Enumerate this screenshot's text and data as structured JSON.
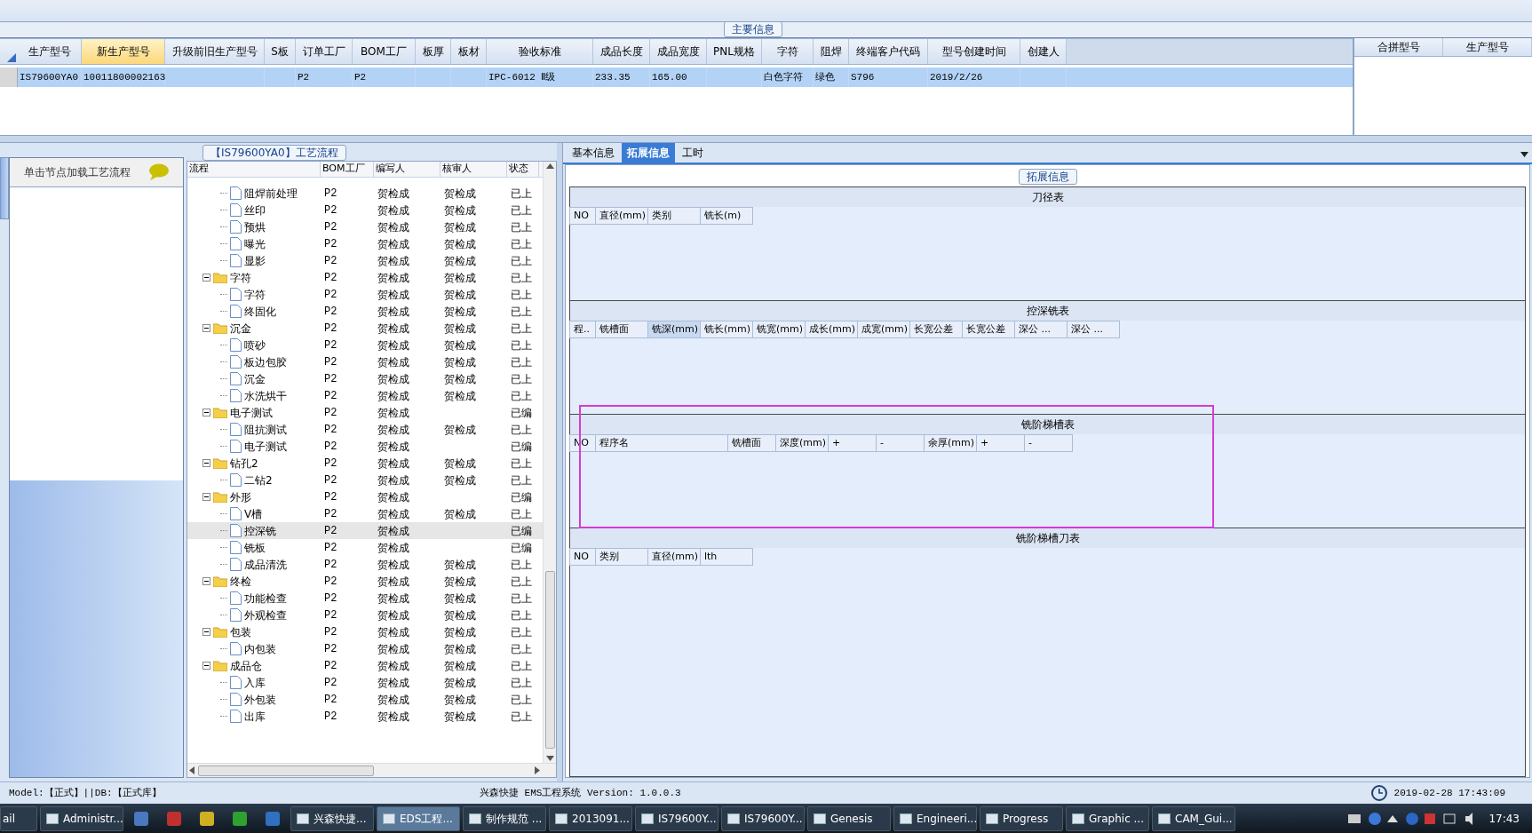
{
  "main_info": {
    "title": "主要信息",
    "columns": [
      {
        "label": "生产型号",
        "selected": false
      },
      {
        "label": "新生产型号",
        "selected": true
      },
      {
        "label": "升级前旧生产型号",
        "selected": false
      },
      {
        "label": "S板",
        "selected": false
      },
      {
        "label": "订单工厂",
        "selected": false
      },
      {
        "label": "BOM工厂",
        "selected": false
      },
      {
        "label": "板厚",
        "selected": false
      },
      {
        "label": "板材",
        "selected": false
      },
      {
        "label": "验收标准",
        "selected": false
      },
      {
        "label": "成品长度",
        "selected": false
      },
      {
        "label": "成品宽度",
        "selected": false
      },
      {
        "label": "PNL规格",
        "selected": false
      },
      {
        "label": "字符",
        "selected": false
      },
      {
        "label": "阻焊",
        "selected": false
      },
      {
        "label": "终端客户代码",
        "selected": false
      },
      {
        "label": "型号创建时间",
        "selected": false
      },
      {
        "label": "创建人",
        "selected": false
      }
    ],
    "rows": [
      {
        "selected": true,
        "cells": [
          "IS79600YA0",
          "10011800002163",
          null,
          null,
          "P2",
          "P2",
          null,
          null,
          "IPC-6012 Ⅱ级",
          "233.35",
          "165.00",
          null,
          "白色字符",
          "绿色",
          "S796",
          "2019/2/26",
          null
        ]
      }
    ],
    "merge_columns": [
      "合拼型号",
      "生产型号"
    ]
  },
  "left_panel": {
    "hint": "单击节点加载工艺流程"
  },
  "process_flow": {
    "title": "【IS79600YA0】工艺流程",
    "columns": [
      "流程",
      "BOM工厂",
      "编写人",
      "核审人",
      "状态"
    ],
    "items": [
      {
        "children": [
          {
            "name": "阻焊前处理",
            "bom": "P2",
            "author": "贺检成",
            "reviewer": "贺检成",
            "status": "已上",
            "selected": false
          },
          {
            "name": "丝印",
            "bom": "P2",
            "author": "贺检成",
            "reviewer": "贺检成",
            "status": "已上",
            "selected": false
          },
          {
            "name": "预烘",
            "bom": "P2",
            "author": "贺检成",
            "reviewer": "贺检成",
            "status": "已上",
            "selected": false
          },
          {
            "name": "曝光",
            "bom": "P2",
            "author": "贺检成",
            "reviewer": "贺检成",
            "status": "已上",
            "selected": false
          },
          {
            "name": "显影",
            "bom": "P2",
            "author": "贺检成",
            "reviewer": "贺检成",
            "status": "已上",
            "selected": false
          }
        ]
      },
      {
        "name": "字符",
        "bom": "P2",
        "author": "贺检成",
        "reviewer": "贺检成",
        "status": "已上",
        "expanded": true,
        "selected": false,
        "children": [
          {
            "name": "字符",
            "bom": "P2",
            "author": "贺检成",
            "reviewer": "贺检成",
            "status": "已上",
            "selected": false
          },
          {
            "name": "终固化",
            "bom": "P2",
            "author": "贺检成",
            "reviewer": "贺检成",
            "status": "已上",
            "selected": false
          }
        ]
      },
      {
        "name": "沉金",
        "bom": "P2",
        "author": "贺检成",
        "reviewer": "贺检成",
        "status": "已上",
        "expanded": true,
        "selected": false,
        "children": [
          {
            "name": "喷砂",
            "bom": "P2",
            "author": "贺检成",
            "reviewer": "贺检成",
            "status": "已上",
            "selected": false
          },
          {
            "name": "板边包胶",
            "bom": "P2",
            "author": "贺检成",
            "reviewer": "贺检成",
            "status": "已上",
            "selected": false
          },
          {
            "name": "沉金",
            "bom": "P2",
            "author": "贺检成",
            "reviewer": "贺检成",
            "status": "已上",
            "selected": false
          },
          {
            "name": "水洗烘干",
            "bom": "P2",
            "author": "贺检成",
            "reviewer": "贺检成",
            "status": "已上",
            "selected": false
          }
        ]
      },
      {
        "name": "电子测试",
        "bom": "P2",
        "author": "贺检成",
        "status": "已编",
        "expanded": true,
        "selected": false,
        "children": [
          {
            "name": "阻抗测试",
            "bom": "P2",
            "author": "贺检成",
            "reviewer": "贺检成",
            "status": "已上",
            "selected": false
          },
          {
            "name": "电子测试",
            "bom": "P2",
            "author": "贺检成",
            "status": "已编",
            "selected": false
          }
        ]
      },
      {
        "name": "钻孔2",
        "bom": "P2",
        "author": "贺检成",
        "reviewer": "贺检成",
        "status": "已上",
        "expanded": true,
        "selected": false,
        "children": [
          {
            "name": "二钻2",
            "bom": "P2",
            "author": "贺检成",
            "reviewer": "贺检成",
            "status": "已上",
            "selected": false
          }
        ]
      },
      {
        "name": "外形",
        "bom": "P2",
        "author": "贺检成",
        "status": "已编",
        "expanded": true,
        "selected": false,
        "children": [
          {
            "name": "V槽",
            "bom": "P2",
            "author": "贺检成",
            "reviewer": "贺检成",
            "status": "已上",
            "selected": false
          },
          {
            "name": "控深铣",
            "bom": "P2",
            "author": "贺检成",
            "status": "已编",
            "selected": true
          },
          {
            "name": "铣板",
            "bom": "P2",
            "author": "贺检成",
            "status": "已编",
            "selected": false
          },
          {
            "name": "成品清洗",
            "bom": "P2",
            "author": "贺检成",
            "reviewer": "贺检成",
            "status": "已上",
            "selected": false
          }
        ]
      },
      {
        "name": "终检",
        "bom": "P2",
        "author": "贺检成",
        "reviewer": "贺检成",
        "status": "已上",
        "expanded": true,
        "selected": false,
        "children": [
          {
            "name": "功能检查",
            "bom": "P2",
            "author": "贺检成",
            "reviewer": "贺检成",
            "status": "已上",
            "selected": false
          },
          {
            "name": "外观检查",
            "bom": "P2",
            "author": "贺检成",
            "reviewer": "贺检成",
            "status": "已上",
            "selected": false
          }
        ]
      },
      {
        "name": "包装",
        "bom": "P2",
        "author": "贺检成",
        "reviewer": "贺检成",
        "status": "已上",
        "expanded": true,
        "selected": false,
        "children": [
          {
            "name": "内包装",
            "bom": "P2",
            "author": "贺检成",
            "reviewer": "贺检成",
            "status": "已上",
            "selected": false
          }
        ]
      },
      {
        "name": "成品仓",
        "bom": "P2",
        "author": "贺检成",
        "reviewer": "贺检成",
        "status": "已上",
        "expanded": true,
        "selected": false,
        "children": [
          {
            "name": "入库",
            "bom": "P2",
            "author": "贺检成",
            "reviewer": "贺检成",
            "status": "已上",
            "selected": false
          },
          {
            "name": "外包装",
            "bom": "P2",
            "author": "贺检成",
            "reviewer": "贺检成",
            "status": "已上",
            "selected": false
          },
          {
            "name": "出库",
            "bom": "P2",
            "author": "贺检成",
            "reviewer": "贺检成",
            "status": "已上",
            "selected": false
          }
        ]
      }
    ]
  },
  "detail": {
    "tabs": [
      {
        "label": "基本信息",
        "selected": false
      },
      {
        "label": "拓展信息",
        "selected": true
      },
      {
        "label": "工时",
        "selected": false
      }
    ],
    "group_title": "拓展信息",
    "tables": [
      {
        "title": "刀径表",
        "columns": [
          {
            "label": "NO",
            "selected": false
          },
          {
            "label": "直径(mm)",
            "selected": false
          },
          {
            "label": "类别",
            "selected": false
          },
          {
            "label": "铣长(m)",
            "selected": false
          }
        ]
      },
      {
        "title": "控深铣表",
        "columns": [
          {
            "label": "程..",
            "selected": false
          },
          {
            "label": "铣槽面",
            "selected": false
          },
          {
            "label": "铣深(mm)",
            "selected": true
          },
          {
            "label": "铣长(mm)",
            "selected": false
          },
          {
            "label": "铣宽(mm)",
            "selected": false
          },
          {
            "label": "成长(mm)",
            "selected": false
          },
          {
            "label": "成宽(mm)",
            "selected": false
          },
          {
            "label": "长宽公差",
            "selected": false
          },
          {
            "label": "长宽公差",
            "selected": false
          },
          {
            "label": "深公 ...",
            "selected": false
          },
          {
            "label": "深公 ...",
            "selected": false
          }
        ]
      },
      {
        "title": "铣阶梯槽表",
        "columns": [
          {
            "label": "NO",
            "selected": false
          },
          {
            "label": "程序名",
            "selected": false
          },
          {
            "label": "铣槽面",
            "selected": false
          },
          {
            "label": "深度(mm)",
            "selected": false
          },
          {
            "label": "+",
            "selected": false
          },
          {
            "label": "-",
            "selected": false
          },
          {
            "label": "余厚(mm)",
            "selected": false
          },
          {
            "label": "+",
            "selected": false
          },
          {
            "label": "-",
            "selected": false
          }
        ]
      },
      {
        "title": "铣阶梯槽刀表",
        "columns": [
          {
            "label": "NO",
            "selected": false
          },
          {
            "label": "类别",
            "selected": false
          },
          {
            "label": "直径(mm)",
            "selected": false
          },
          {
            "label": "lth",
            "selected": false
          }
        ]
      }
    ]
  },
  "status_bar": {
    "model": "Model:【正式】||DB:【正式库】",
    "app": "兴森快捷 EMS工程系统 Version: 1.0.0.3",
    "datetime": "2019-02-28 17:43:09"
  },
  "taskbar": {
    "items": [
      {
        "kind": "task",
        "label": "ail",
        "selected": false
      },
      {
        "kind": "task",
        "label": "Administr...",
        "selected": false
      },
      {
        "kind": "icon",
        "color": "#4a78c0",
        "selected": false
      },
      {
        "kind": "icon",
        "color": "#c03030",
        "selected": false
      },
      {
        "kind": "icon",
        "color": "#d0b020",
        "selected": false
      },
      {
        "kind": "icon",
        "color": "#30a030",
        "selected": false
      },
      {
        "kind": "icon",
        "color": "#3070c0",
        "selected": false
      },
      {
        "kind": "task",
        "label": "兴森快捷...",
        "selected": false
      },
      {
        "kind": "task",
        "label": "EDS工程...",
        "selected": true
      },
      {
        "kind": "task",
        "label": "制作规范 ...",
        "selected": false
      },
      {
        "kind": "task",
        "label": "2013091...",
        "selected": false
      },
      {
        "kind": "task",
        "label": "IS79600Y...",
        "selected": false
      },
      {
        "kind": "task",
        "label": "IS79600Y...",
        "selected": false
      },
      {
        "kind": "task",
        "label": "Genesis",
        "selected": false
      },
      {
        "kind": "task",
        "label": "Engineeri...",
        "selected": false
      },
      {
        "kind": "task",
        "label": "Progress",
        "selected": false
      },
      {
        "kind": "task",
        "label": "Graphic ...",
        "selected": false
      },
      {
        "kind": "task",
        "label": "CAM_Gui...",
        "selected": false
      }
    ],
    "clock": "17:43"
  }
}
